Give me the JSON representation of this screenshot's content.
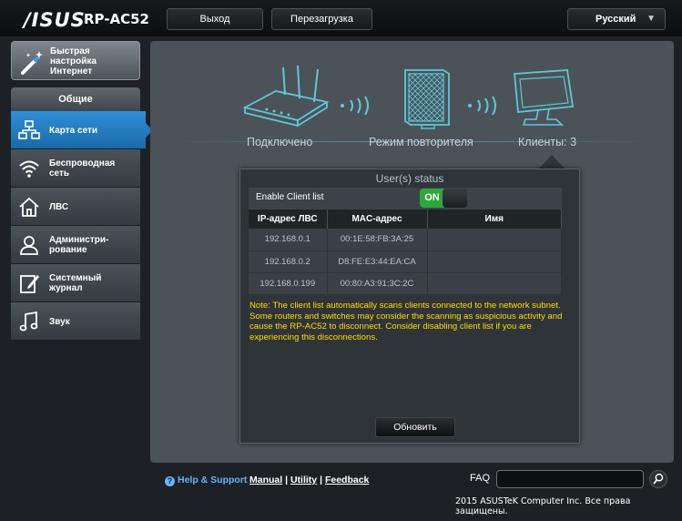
{
  "header": {
    "logo": "/ISUS",
    "model": "RP-AC52",
    "logout_label": "Выход",
    "reboot_label": "Перезагрузка",
    "language": "Русский"
  },
  "sidebar": {
    "quick_setup_label": "Быстрая настройка Интернет",
    "section_title": "Общие",
    "items": [
      {
        "label": "Карта сети",
        "icon": "network-map-icon",
        "active": true
      },
      {
        "label": "Беспроводная сеть",
        "icon": "wifi-icon",
        "active": false
      },
      {
        "label": "ЛВС",
        "icon": "home-icon",
        "active": false
      },
      {
        "label": "Админист­ри-рование",
        "icon": "user-icon",
        "active": false
      },
      {
        "label": "Системный журнал",
        "icon": "log-icon",
        "active": false
      },
      {
        "label": "Звук",
        "icon": "music-note-icon",
        "active": false
      }
    ]
  },
  "topology": {
    "connected_label": "Подключено",
    "repeater_label": "Режим повторителя",
    "clients_label": "Клиенты: 3"
  },
  "user_status": {
    "title": "User(s) status",
    "enable_label": "Enable Client list",
    "toggle_label": "ON",
    "columns": [
      "IP-адрес ЛВС",
      "MAC-адрес",
      "Имя"
    ],
    "rows": [
      {
        "ip": "192.168.0.1",
        "mac": "00:1E:58:FB:3A:25",
        "name": ""
      },
      {
        "ip": "192.168.0.2",
        "mac": "D8:FE:E3:44:EA:CA",
        "name": ""
      },
      {
        "ip": "192.168.0.199",
        "mac": "00:80:A3:91:3C:2C",
        "name": ""
      }
    ],
    "note": "Note: The client list automatically scans clients connected to the network subnet. Some routers and switches may consider the scanning as suspicious activity and cause the RP-AC52 to disconnect. Consider disabling client list if you are experiencing this disconnections.",
    "refresh_label": "Обновить"
  },
  "footer": {
    "help_label": "Help & Support",
    "manual_label": "Manual",
    "utility_label": "Utility",
    "feedback_label": "Feedback",
    "separator": "|",
    "faq_label": "FAQ",
    "faq_value": "",
    "copyright": "2015 ASUSTeK Computer Inc. Все права защищены."
  },
  "colors": {
    "accent_blue": "#1f7bc0",
    "toggle_on": "#2fa83a",
    "note_yellow": "#ffdd00",
    "topology_cyan": "#5ec8d8"
  }
}
